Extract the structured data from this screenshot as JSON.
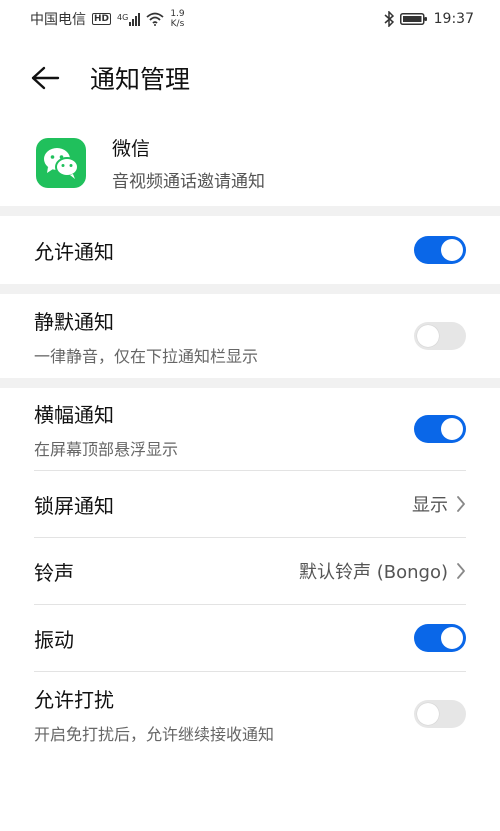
{
  "status_bar": {
    "carrier": "中国电信",
    "hd_badge": "HD",
    "network": "4G",
    "speed_value": "1.9",
    "speed_unit": "K/s",
    "time": "19:37"
  },
  "header": {
    "title": "通知管理"
  },
  "app": {
    "name": "微信",
    "description": "音视频通话邀请通知",
    "icon_color": "#20c05c"
  },
  "settings": {
    "allow_notifications": {
      "label": "允许通知",
      "enabled": true
    },
    "silent_notifications": {
      "label": "静默通知",
      "subtitle": "一律静音，仅在下拉通知栏显示",
      "enabled": false
    },
    "banner_notifications": {
      "label": "横幅通知",
      "subtitle": "在屏幕顶部悬浮显示",
      "enabled": true
    },
    "lock_screen_notifications": {
      "label": "锁屏通知",
      "value": "显示"
    },
    "ringtone": {
      "label": "铃声",
      "value": "默认铃声 (Bongo)"
    },
    "vibration": {
      "label": "振动",
      "enabled": true
    },
    "allow_dnd": {
      "label": "允许打扰",
      "subtitle": "开启免打扰后，允许继续接收通知",
      "enabled": false
    }
  },
  "colors": {
    "accent": "#0a67e8",
    "toggle_off": "#e6e6e6",
    "section_gap": "#f1f1f1"
  }
}
